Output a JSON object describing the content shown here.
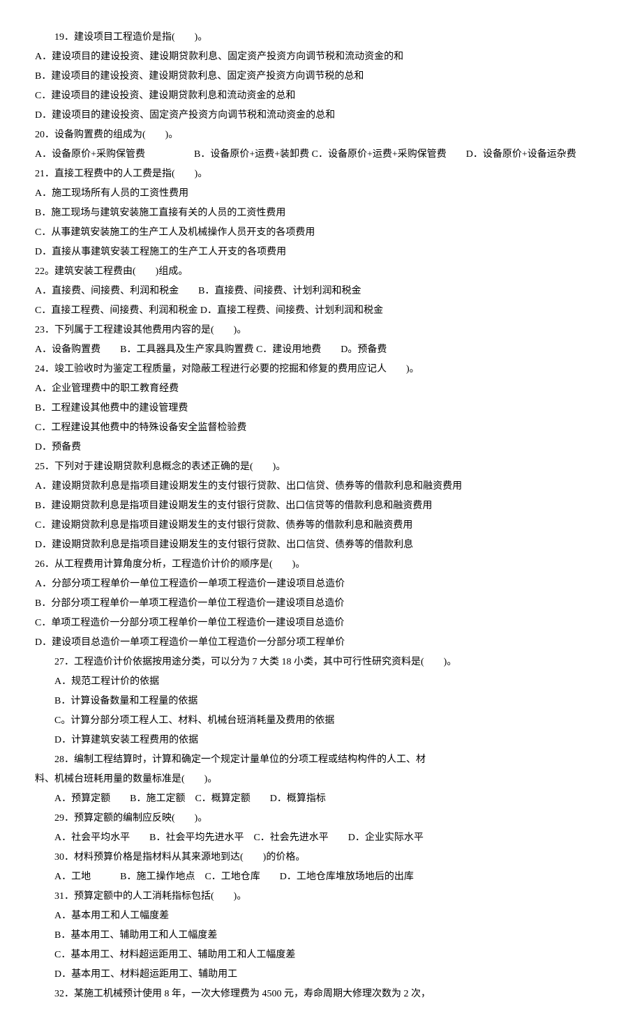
{
  "lines": [
    {
      "text": "19．建设项目工程造价是指(　　)。",
      "indent": true
    },
    {
      "text": "A．建设项目的建设投资、建设期贷款利息、固定资产投资方向调节税和流动资金的和",
      "indent": false
    },
    {
      "text": "B．建设项目的建设投资、建设期贷款利息、固定资产投资方向调节税的总和",
      "indent": false
    },
    {
      "text": "C．建设项目的建设投资、建设期贷款利息和流动资金的总和",
      "indent": false
    },
    {
      "text": "D．建设项目的建设投资、固定资产投资方向调节税和流动资金的总和",
      "indent": false
    },
    {
      "text": "20．设备购置费的组成为(　　)。",
      "indent": false
    },
    {
      "text": "A．设备原价+采购保管费　　　　　B．设备原价+运费+装卸费 C．设备原价+运费+采购保管费　　D．设备原价+设备运杂费",
      "indent": false
    },
    {
      "text": "21．直接工程费中的人工费是指(　　)。",
      "indent": false
    },
    {
      "text": "A．施工现场所有人员的工资性费用",
      "indent": false
    },
    {
      "text": "B．施工现场与建筑安装施工直接有关的人员的工资性费用",
      "indent": false
    },
    {
      "text": "C．从事建筑安装施工的生产工人及机械操作人员开支的各项费用",
      "indent": false
    },
    {
      "text": "D．直接从事建筑安装工程施工的生产工人开支的各项费用",
      "indent": false
    },
    {
      "text": "22。建筑安装工程费由(　　)组成。",
      "indent": false
    },
    {
      "text": "A．直接费、间接费、利润和税金　　B．直接费、间接费、计划利润和税金",
      "indent": false
    },
    {
      "text": "C．直接工程费、间接费、利润和税金  D．直接工程费、间接费、计划利润和税金",
      "indent": false
    },
    {
      "text": "23．下列属于工程建设其他费用内容的是(　　)。",
      "indent": false
    },
    {
      "text": "A．设备购置费　　B．工具器具及生产家具购置费 C．建设用地费　　D。预备费",
      "indent": false
    },
    {
      "text": "24．竣工验收时为鉴定工程质量，对隐蔽工程进行必要的挖掘和修复的费用应记人　　)。",
      "indent": false
    },
    {
      "text": "A．企业管理费中的职工教育经费",
      "indent": false
    },
    {
      "text": "B．工程建设其他费中的建设管理费",
      "indent": false
    },
    {
      "text": "C．工程建设其他费中的特殊设备安全监督检验费",
      "indent": false
    },
    {
      "text": "D．预备费",
      "indent": false
    },
    {
      "text": "25．下列对于建设期贷款利息概念的表述正确的是(　　)。",
      "indent": false
    },
    {
      "text": "A．建设期贷款利息是指项目建设期发生的支付银行贷款、出口信贷、债券等的借款利息和融资费用",
      "indent": false
    },
    {
      "text": "B．建设期贷款利息是指项目建设期发生的支付银行贷款、出口信贷等的借款利息和融资费用",
      "indent": false
    },
    {
      "text": "C．建设期贷款利息是指项目建设期发生的支付银行贷款、债券等的借款利息和融资费用",
      "indent": false
    },
    {
      "text": "D．建设期贷款利息是指项目建设期发生的支付银行贷款、出口信贷、债券等的借款利息",
      "indent": false
    },
    {
      "text": "26．从工程费用计算角度分析，工程造价计价的顺序是(　　)。",
      "indent": false
    },
    {
      "text": "A．分部分项工程单价一单位工程造价一单项工程造价一建设项目总造价",
      "indent": false
    },
    {
      "text": "B．分部分项工程单价一单项工程造价一单位工程造价一建设项目总造价",
      "indent": false
    },
    {
      "text": "C．单项工程造价一分部分项工程单价一单位工程造价一建设项目总造价",
      "indent": false
    },
    {
      "text": "D．建设项目总造价一单项工程造价一单位工程造价一分部分项工程单价",
      "indent": false
    },
    {
      "text": "27．工程造价计价依据按用途分类，可以分为 7 大类 18 小类，其中可行性研究资料是(　　)。",
      "indent": true
    },
    {
      "text": "A．规范工程计价的依据",
      "indent": true
    },
    {
      "text": "B．计算设备数量和工程量的依据",
      "indent": true
    },
    {
      "text": "C。计算分部分项工程人工、材料、机械台班消耗量及费用的依据",
      "indent": true
    },
    {
      "text": "D．计算建筑安装工程费用的依据",
      "indent": true
    },
    {
      "text": "28．编制工程结算时，计算和确定一个规定计量单位的分项工程或结构构件的人工、材",
      "indent": true
    },
    {
      "text": "料、机械台班耗用量的数量标准是(　　)。",
      "indent": false
    },
    {
      "text": "A．预算定额　　B．施工定额　C．概算定额　　D．概算指标",
      "indent": true
    },
    {
      "text": "29．预算定额的编制应反映(　　)。",
      "indent": true
    },
    {
      "text": "A．社会平均水平　　B．社会平均先进水平　C．社会先进水平　　D．企业实际水平",
      "indent": true
    },
    {
      "text": "30．材料预算价格是指材料从其来源地到达(　　)的价格。",
      "indent": true
    },
    {
      "text": "A．工地　　　B．施工操作地点　C．工地仓库　　D．工地仓库堆放场地后的出库",
      "indent": true
    },
    {
      "text": "31．预算定额中的人工消耗指标包括(　　)。",
      "indent": true
    },
    {
      "text": "A．基本用工和人工幅度差",
      "indent": true
    },
    {
      "text": "B．基本用工、辅助用工和人工幅度差",
      "indent": true
    },
    {
      "text": "C．基本用工、材料超运距用工、辅助用工和人工幅度差",
      "indent": true
    },
    {
      "text": "D．基本用工、材料超运距用工、辅助用工",
      "indent": true
    },
    {
      "text": "32．某施工机械预计使用 8 年，一次大修理费为 4500 元，寿命周期大修理次数为 2 次，",
      "indent": true
    }
  ]
}
